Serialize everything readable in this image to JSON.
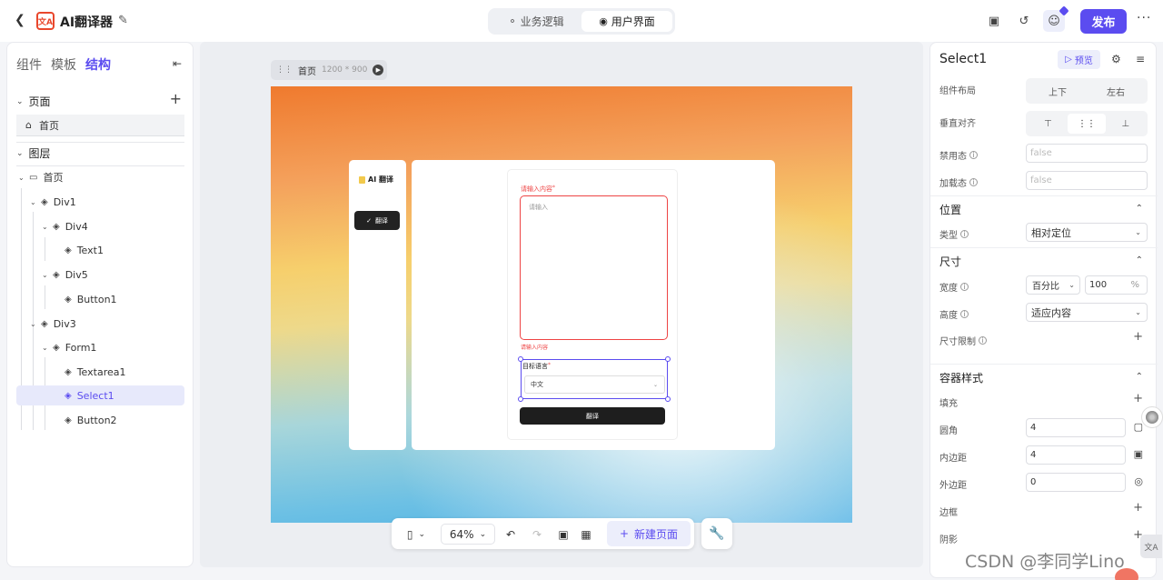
{
  "header": {
    "app_title": "AI翻译器",
    "modes": [
      "业务逻辑",
      "用户界面"
    ],
    "publish_label": "发布",
    "more_label": "···"
  },
  "left": {
    "tabs": [
      "组件",
      "模板",
      "结构"
    ],
    "pages_title": "页面",
    "page_item": "首页",
    "layers_title": "图层",
    "tree": [
      {
        "label": "首页",
        "depth": 0,
        "icon": "monitor-icon"
      },
      {
        "label": "Div1",
        "depth": 1,
        "icon": "layers-icon"
      },
      {
        "label": "Div4",
        "depth": 2,
        "icon": "layers-icon"
      },
      {
        "label": "Text1",
        "depth": 3,
        "icon": "layers-icon"
      },
      {
        "label": "Div5",
        "depth": 2,
        "icon": "layers-icon"
      },
      {
        "label": "Button1",
        "depth": 3,
        "icon": "layers-icon"
      },
      {
        "label": "Div3",
        "depth": 1,
        "icon": "layers-icon"
      },
      {
        "label": "Form1",
        "depth": 2,
        "icon": "layers-icon"
      },
      {
        "label": "Textarea1",
        "depth": 3,
        "icon": "layers-icon"
      },
      {
        "label": "Select1",
        "depth": 3,
        "icon": "layers-icon",
        "selected": true
      },
      {
        "label": "Button2",
        "depth": 3,
        "icon": "layers-icon"
      }
    ]
  },
  "canvas": {
    "page_name": "首页",
    "page_size": "1200 * 900",
    "preview": {
      "logo": "AI 翻译",
      "nav_button": "翻译",
      "input_label": "请输入内容",
      "textarea_placeholder": "请输入",
      "error_text": "请输入内容",
      "select_label": "目标语言",
      "select_value": "中文",
      "submit_label": "翻译"
    }
  },
  "toolbar": {
    "zoom": "64%",
    "new_page": "新建页面"
  },
  "right": {
    "title": "Select1",
    "preview_label": "预览",
    "layout_label": "组件布局",
    "layout_options": [
      "上下",
      "左右"
    ],
    "valign_label": "垂直对齐",
    "disabled_label": "禁用态",
    "disabled_value": "false",
    "loading_label": "加载态",
    "loading_value": "false",
    "position_section": "位置",
    "type_label": "类型",
    "type_value": "相对定位",
    "size_section": "尺寸",
    "width_label": "宽度",
    "width_unit": "百分比",
    "width_value": "100",
    "width_suffix": "%",
    "height_label": "高度",
    "height_value": "适应内容",
    "size_limit_label": "尺寸限制",
    "container_section": "容器样式",
    "fill_label": "填充",
    "radius_label": "圆角",
    "radius_value": "4",
    "padding_label": "内边距",
    "padding_value": "4",
    "margin_label": "外边距",
    "margin_value": "0",
    "border_label": "边框",
    "shadow_label": "阴影"
  },
  "watermark": "CSDN @李同学Lino",
  "colors": {
    "accent": "#5b4cf0",
    "error": "#e44444"
  }
}
